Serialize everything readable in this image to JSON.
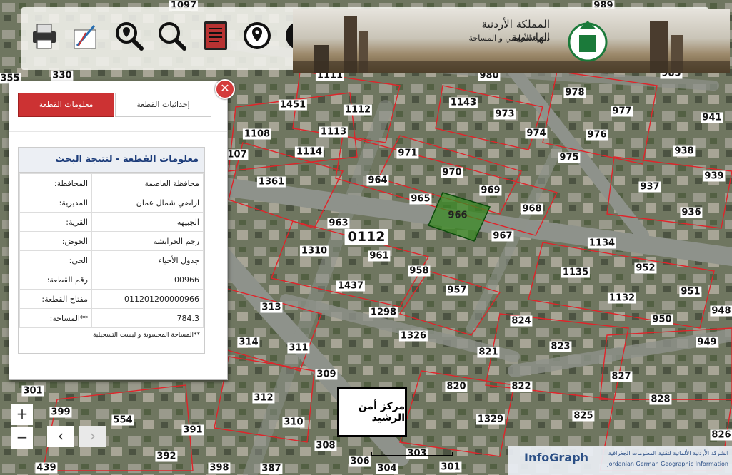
{
  "toolbar": {
    "tools": [
      {
        "name": "print-icon"
      },
      {
        "name": "measure-icon"
      },
      {
        "name": "search-location-icon"
      },
      {
        "name": "search-icon"
      },
      {
        "name": "report-icon"
      },
      {
        "name": "location-pin-icon"
      },
      {
        "name": "info-icon"
      }
    ]
  },
  "banner": {
    "title": "المملكة الأردنية الهاشمية",
    "subtitle": "دائرة الأراضي و المساحة"
  },
  "panel": {
    "close_symbol": "✕",
    "tab_info": "معلومات القطعة",
    "tab_coords": "إحداثيات القطعة",
    "title": "معلومات القطعة - لنتيجة البحث",
    "rows": [
      {
        "label": "المحافظة:",
        "value": "محافظة العاصمة"
      },
      {
        "label": "المديرية:",
        "value": "اراضي شمال عمان"
      },
      {
        "label": "القرية:",
        "value": "الجبيهه"
      },
      {
        "label": "الحوض:",
        "value": "رجم الخرابشه"
      },
      {
        "label": "الحي:",
        "value": "جدول الأحياء"
      },
      {
        "label": "رقم القطعة:",
        "value": "00966"
      },
      {
        "label": "مفتاح القطعة:",
        "value": "011201200000966"
      },
      {
        "label": "**المساحة:",
        "value": "784.3"
      }
    ],
    "note": "**المساحة المحسوبة و ليست التسجيلية"
  },
  "zoom": {
    "in": "+",
    "out": "−"
  },
  "nav": {
    "prev": "‹",
    "next": "›"
  },
  "landmark": "مركز أمن الرشيد",
  "block_label": "0112",
  "plots": [
    {
      "t": "1097"
    },
    {
      "t": "989"
    },
    {
      "t": "330"
    },
    {
      "t": "1111"
    },
    {
      "t": "980"
    },
    {
      "t": "985"
    },
    {
      "t": "1451"
    },
    {
      "t": "1112"
    },
    {
      "t": "1143"
    },
    {
      "t": "978"
    },
    {
      "t": "973"
    },
    {
      "t": "977"
    },
    {
      "t": "941"
    },
    {
      "t": "1108"
    },
    {
      "t": "1113"
    },
    {
      "t": "974"
    },
    {
      "t": "976"
    },
    {
      "t": "107"
    },
    {
      "t": "1114"
    },
    {
      "t": "971"
    },
    {
      "t": "975"
    },
    {
      "t": "938"
    },
    {
      "t": "970"
    },
    {
      "t": "964"
    },
    {
      "t": "1361"
    },
    {
      "t": "969"
    },
    {
      "t": "939"
    },
    {
      "t": "937"
    },
    {
      "t": "965"
    },
    {
      "t": "968"
    },
    {
      "t": "966"
    },
    {
      "t": "936"
    },
    {
      "t": "963"
    },
    {
      "t": "967"
    },
    {
      "t": "1310"
    },
    {
      "t": "1134"
    },
    {
      "t": "961"
    },
    {
      "t": "958"
    },
    {
      "t": "952"
    },
    {
      "t": "1135"
    },
    {
      "t": "1437"
    },
    {
      "t": "957"
    },
    {
      "t": "951"
    },
    {
      "t": "1132"
    },
    {
      "t": "313"
    },
    {
      "t": "1298"
    },
    {
      "t": "948"
    },
    {
      "t": "824"
    },
    {
      "t": "950"
    },
    {
      "t": "1326"
    },
    {
      "t": "314"
    },
    {
      "t": "311"
    },
    {
      "t": "821"
    },
    {
      "t": "823"
    },
    {
      "t": "949"
    },
    {
      "t": "309"
    },
    {
      "t": "827"
    },
    {
      "t": "820"
    },
    {
      "t": "822"
    },
    {
      "t": "301"
    },
    {
      "t": "312"
    },
    {
      "t": "828"
    },
    {
      "t": "399"
    },
    {
      "t": "554"
    },
    {
      "t": "1329"
    },
    {
      "t": "825"
    },
    {
      "t": "310"
    },
    {
      "t": "391"
    },
    {
      "t": "826"
    },
    {
      "t": "308"
    },
    {
      "t": "392"
    },
    {
      "t": "303"
    },
    {
      "t": "306"
    },
    {
      "t": "304"
    },
    {
      "t": "301"
    },
    {
      "t": "439"
    },
    {
      "t": "398"
    },
    {
      "t": "387"
    },
    {
      "t": "355"
    }
  ],
  "footer": {
    "brand": "InfoGraph",
    "org_line1": "الشركة الأردنية الألمانية لتقنية المعلومات الجغرافية",
    "org_line2": "Jordanian German Geographic Information"
  }
}
